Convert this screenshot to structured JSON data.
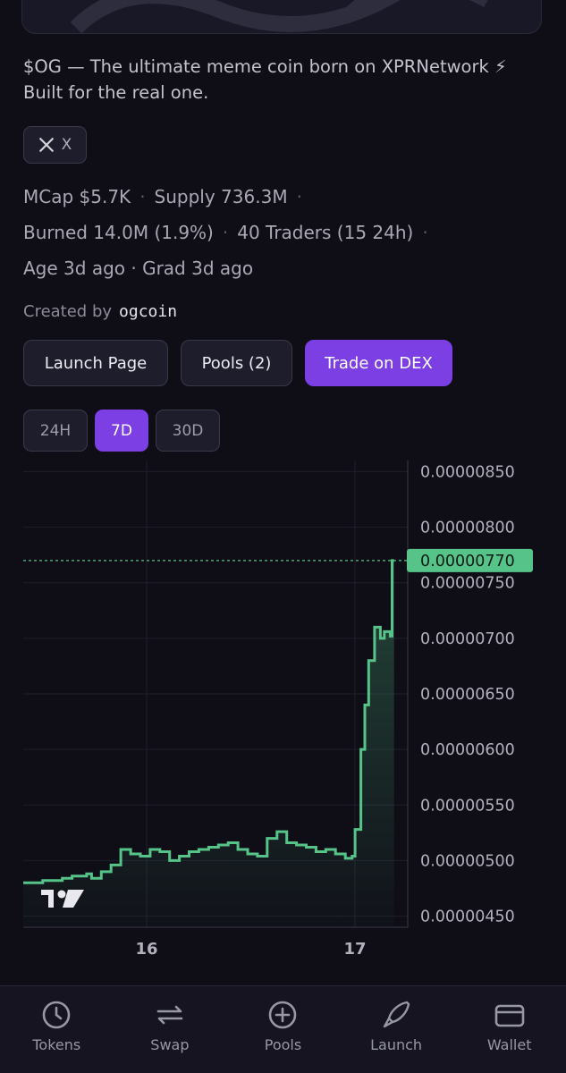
{
  "token": {
    "description": "$OG — The ultimate meme coin born on XPRNetwork ⚡ Built for the real one."
  },
  "social": {
    "label": "X"
  },
  "stats": {
    "mcap": "MCap $5.7K",
    "supply": "Supply 736.3M",
    "burned": "Burned 14.0M (1.9%)",
    "traders": "40 Traders (15 24h)",
    "age": "Age 3d ago · Grad 3d ago"
  },
  "created": {
    "label": "Created by",
    "creator": "ogcoin"
  },
  "actions": {
    "launch_page": "Launch Page",
    "pools": "Pools (2)",
    "trade": "Trade on DEX"
  },
  "ranges": [
    "24H",
    "7D",
    "30D"
  ],
  "active_range": "7D",
  "colors": {
    "accent": "#7b3fe4",
    "line": "#56c489",
    "background": "#0f0e17"
  },
  "chart_data": {
    "type": "area",
    "y_ticks": [
      "0.00000850",
      "0.00000800",
      "0.00000750",
      "0.00000700",
      "0.00000650",
      "0.00000600",
      "0.00000550",
      "0.00000500",
      "0.00000450"
    ],
    "x_ticks": [
      "16",
      "17"
    ],
    "ylim": [
      4.4e-06,
      8.6e-06
    ],
    "last_price": "0.00000770",
    "last_value": 7.7e-06,
    "grid": true,
    "points": [
      [
        0,
        4.8e-06
      ],
      [
        2,
        4.82e-06
      ],
      [
        4,
        4.84e-06
      ],
      [
        5,
        4.86e-06
      ],
      [
        6.5,
        4.88e-06
      ],
      [
        7,
        4.84e-06
      ],
      [
        8,
        4.9e-06
      ],
      [
        9,
        4.96e-06
      ],
      [
        10,
        5.1e-06
      ],
      [
        11,
        5.06e-06
      ],
      [
        12,
        5.04e-06
      ],
      [
        13,
        5.1e-06
      ],
      [
        14,
        5.08e-06
      ],
      [
        15,
        5e-06
      ],
      [
        16,
        5.04e-06
      ],
      [
        17,
        5.08e-06
      ],
      [
        18,
        5.1e-06
      ],
      [
        19,
        5.12e-06
      ],
      [
        20,
        5.14e-06
      ],
      [
        21,
        5.16e-06
      ],
      [
        22,
        5.1e-06
      ],
      [
        23,
        5.06e-06
      ],
      [
        24,
        5.04e-06
      ],
      [
        25,
        5.2e-06
      ],
      [
        26,
        5.26e-06
      ],
      [
        27,
        5.16e-06
      ],
      [
        28,
        5.14e-06
      ],
      [
        29,
        5.12e-06
      ],
      [
        30,
        5.08e-06
      ],
      [
        31,
        5.1e-06
      ],
      [
        32,
        5.06e-06
      ],
      [
        33,
        5.02e-06
      ],
      [
        33.7,
        5.04e-06
      ],
      [
        34,
        5.28e-06
      ],
      [
        34.6,
        6e-06
      ],
      [
        35,
        6.4e-06
      ],
      [
        35.4,
        6.8e-06
      ],
      [
        36,
        7.1e-06
      ],
      [
        36.6,
        7e-06
      ],
      [
        37,
        7.06e-06
      ],
      [
        37.6,
        7.02e-06
      ],
      [
        37.8,
        7.7e-06
      ],
      [
        38,
        7.7e-06
      ]
    ]
  },
  "nav": [
    {
      "label": "Tokens",
      "icon": "clock-icon"
    },
    {
      "label": "Swap",
      "icon": "swap-icon"
    },
    {
      "label": "Pools",
      "icon": "plus-circle-icon"
    },
    {
      "label": "Launch",
      "icon": "rocket-icon"
    },
    {
      "label": "Wallet",
      "icon": "wallet-icon"
    }
  ]
}
